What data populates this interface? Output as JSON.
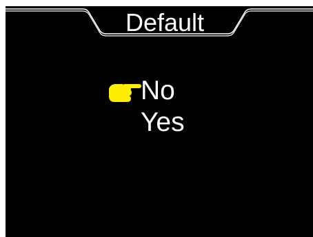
{
  "screen": {
    "title": "Default"
  },
  "menu": {
    "items": [
      {
        "label": "No",
        "selected": true
      },
      {
        "label": "Yes",
        "selected": false
      }
    ],
    "pointer_icon": "pointing-hand-icon",
    "pointer_color": "#ffee00"
  },
  "colors": {
    "background": "#000000",
    "text": "#ffffff",
    "frame": "#ffffff"
  }
}
